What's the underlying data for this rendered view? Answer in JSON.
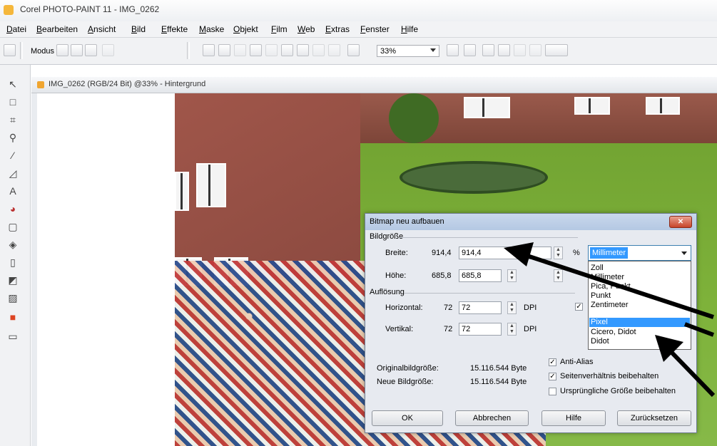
{
  "window": {
    "title": "Corel PHOTO-PAINT 11 - IMG_0262"
  },
  "menu": [
    "Datei",
    "Bearbeiten",
    "Ansicht",
    "Bild",
    "Effekte",
    "Maske",
    "Objekt",
    "Film",
    "Web",
    "Extras",
    "Fenster",
    "Hilfe"
  ],
  "toolbar": {
    "modus_label": "Modus",
    "zoom": "33%"
  },
  "document": {
    "title": "IMG_0262 (RGB/24 Bit) @33% - Hintergrund"
  },
  "dialog": {
    "title": "Bitmap neu aufbauen",
    "group_size": "Bildgröße",
    "width_label": "Breite:",
    "width_orig": "914,4",
    "width_value": "914,4",
    "height_label": "Höhe:",
    "height_orig": "685,8",
    "height_value": "685,8",
    "percent": "%",
    "group_resolution": "Auflösung",
    "horiz_label": "Horizontal:",
    "horiz_orig": "72",
    "horiz_value": "72",
    "vert_label": "Vertikal:",
    "vert_orig": "72",
    "vert_value": "72",
    "dpi": "DPI",
    "orig_size_label": "Originalbildgröße:",
    "orig_size_value": "15.116.544 Byte",
    "new_size_label": "Neue Bildgröße:",
    "new_size_value": "15.116.544 Byte",
    "antialias": "Anti-Alias",
    "keep_ratio": "Seitenverhältnis beibehalten",
    "keep_orig": "Ursprüngliche Größe beibehalten",
    "ok": "OK",
    "cancel": "Abbrechen",
    "help": "Hilfe",
    "reset": "Zurücksetzen",
    "unit_selected": "Millimeter",
    "units": [
      "Zoll",
      "Millimeter",
      "Pica, Punkt",
      "Punkt",
      "Zentimeter",
      "Pixel",
      "Cicero, Didot",
      "Didot"
    ],
    "units_highlighted": "Pixel"
  }
}
